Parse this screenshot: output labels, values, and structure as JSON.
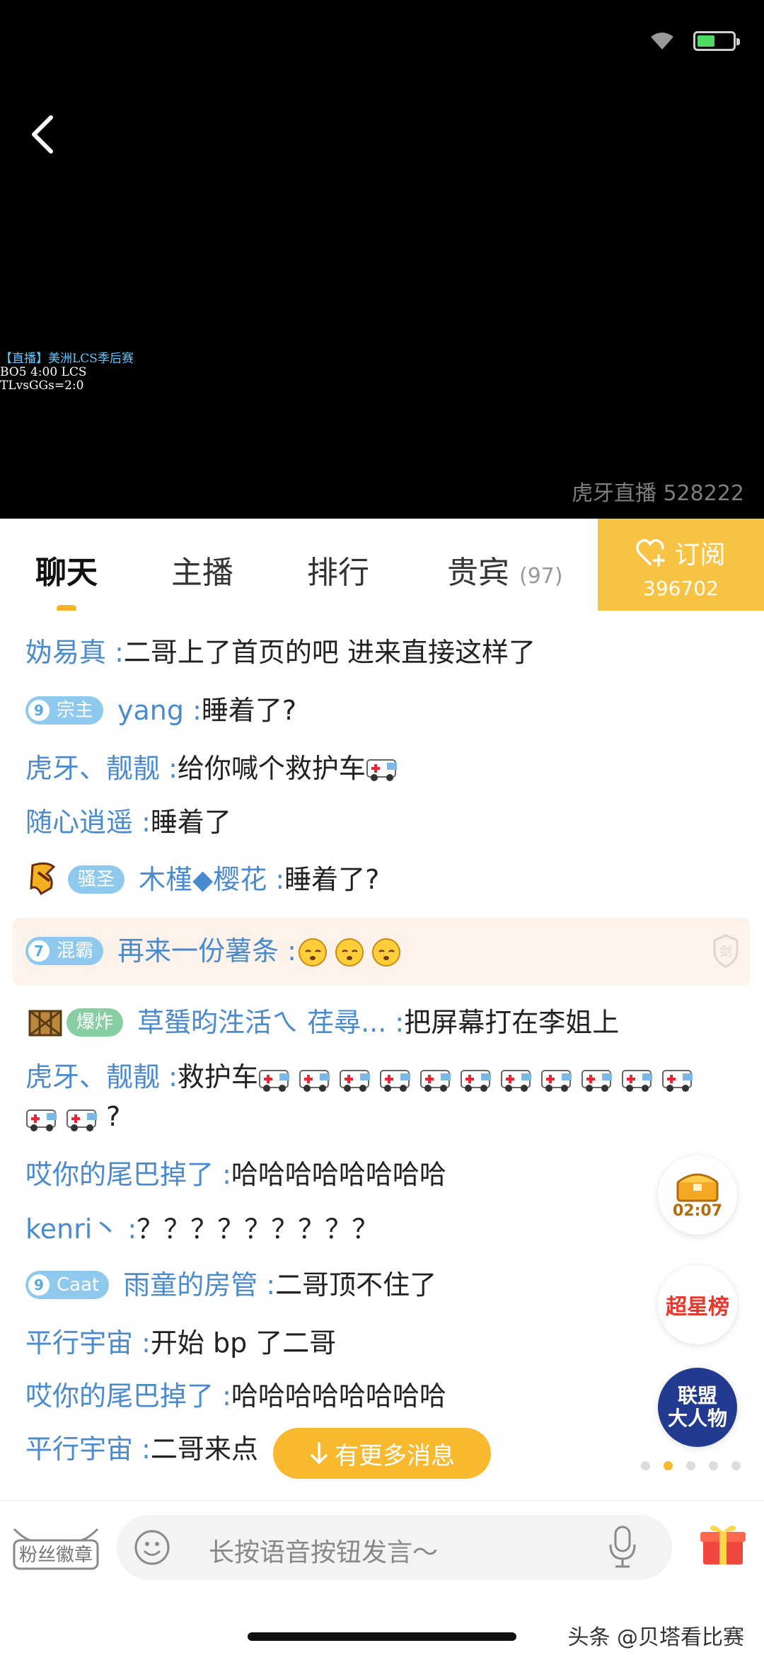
{
  "video": {
    "overlay_line1": "【直播】美洲LCS季后赛",
    "overlay_line2": "BO5 4:00 LCS",
    "overlay_line3": "TLvsGGs=2:0",
    "watermark": "虎牙直播 528222"
  },
  "tabs": [
    {
      "label": "聊天",
      "active": true
    },
    {
      "label": "主播"
    },
    {
      "label": "排行"
    },
    {
      "label": "贵宾",
      "count": "(97)"
    }
  ],
  "subscribe": {
    "label": "订阅",
    "count": "396702"
  },
  "chat": [
    {
      "name": "妫易真 : ",
      "text": "二哥上了首页的吧 进来直接这样了"
    },
    {
      "badge": {
        "level": "9",
        "title": "宗主"
      },
      "name": "yang : ",
      "text": "睡着了?"
    },
    {
      "name": "虎牙、靓靓 : ",
      "text": "给你喊个救护车"
    },
    {
      "name": "随心逍遥 : ",
      "text": "睡着了"
    },
    {
      "badge": {
        "title": "骚圣"
      },
      "name": "木槿◆樱花 : ",
      "text": "睡着了?"
    },
    {
      "badge": {
        "level": "7",
        "title": "混霸"
      },
      "name": "再来一份薯条 : ",
      "text": ""
    },
    {
      "badge": {
        "title": "爆炸"
      },
      "name": "草蜑昀泩活ㄟ 荏尋... : ",
      "text": "把屏幕打在李姐上"
    },
    {
      "name": "虎牙、靓靓 : ",
      "text": "救护车",
      "text2": "?"
    },
    {
      "name": "哎你的尾巴掉了 : ",
      "text": "哈哈哈哈哈哈哈哈"
    },
    {
      "name": "kenri丶 : ",
      "text": "？？？？？？？？？"
    },
    {
      "badge": {
        "level": "9",
        "title": "Caat"
      },
      "name": "雨童的房管 : ",
      "text": "二哥顶不住了"
    },
    {
      "name": "平行宇宙 : ",
      "text": "开始 bp 了二哥"
    },
    {
      "name": "哎你的尾巴掉了 : ",
      "text": "哈哈哈哈哈哈哈哈"
    },
    {
      "name": "平行宇宙 : ",
      "text": "二哥来点"
    }
  ],
  "more_messages": "有更多消息",
  "widgets": {
    "chest_timer": "02:07",
    "super_star": "超星榜",
    "league_line1": "联盟",
    "league_line2": "大人物"
  },
  "bottom": {
    "fan_badge": "粉丝徽章",
    "placeholder": "长按语音按钮发言～"
  },
  "source": "头条 @贝塔看比赛",
  "colors": {
    "accent": "#f8b92e",
    "username": "#4a8bcf"
  }
}
